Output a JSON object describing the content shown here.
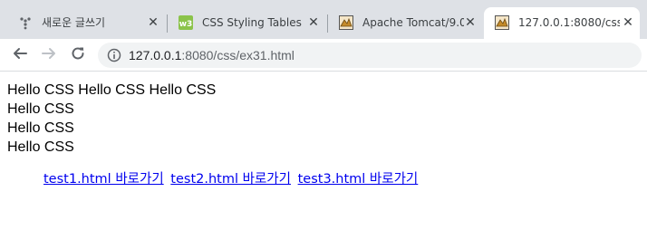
{
  "tabs": [
    {
      "title": "새로운 글쓰기",
      "favicon": "dots-icon",
      "active": false
    },
    {
      "title": "CSS Styling Tables",
      "favicon": "w3schools-icon",
      "active": false
    },
    {
      "title": "Apache Tomcat/9.0",
      "favicon": "tomcat-icon",
      "active": false
    },
    {
      "title": "127.0.0.1:8080/css/e",
      "favicon": "tomcat-icon",
      "active": true
    }
  ],
  "address_bar": {
    "host": "127.0.0.1",
    "rest": ":8080/css/ex31.html"
  },
  "page": {
    "inline_texts": [
      "Hello CSS",
      "Hello CSS",
      "Hello CSS"
    ],
    "block_texts": [
      "Hello CSS",
      "Hello CSS",
      "Hello CSS"
    ],
    "links": [
      "test1.html 바로가기",
      "test2.html 바로가기",
      "test3.html 바로가기"
    ]
  },
  "colors": {
    "tabstrip_bg": "#dee1e6",
    "link": "#0000ee"
  }
}
